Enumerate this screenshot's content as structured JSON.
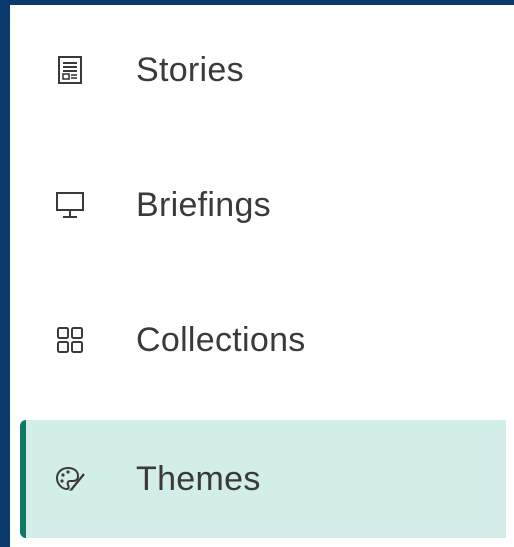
{
  "nav": {
    "items": [
      {
        "label": "Stories",
        "icon": "stories-document-icon",
        "active": false
      },
      {
        "label": "Briefings",
        "icon": "presentation-board-icon",
        "active": false
      },
      {
        "label": "Collections",
        "icon": "grid-squares-icon",
        "active": false
      },
      {
        "label": "Themes",
        "icon": "palette-brush-icon",
        "active": true
      }
    ]
  },
  "colors": {
    "frame": "#0b3a6e",
    "panel": "#ffffff",
    "active_bg": "#d3ede8",
    "active_accent": "#0f7a64",
    "text": "#3a3a3a"
  }
}
